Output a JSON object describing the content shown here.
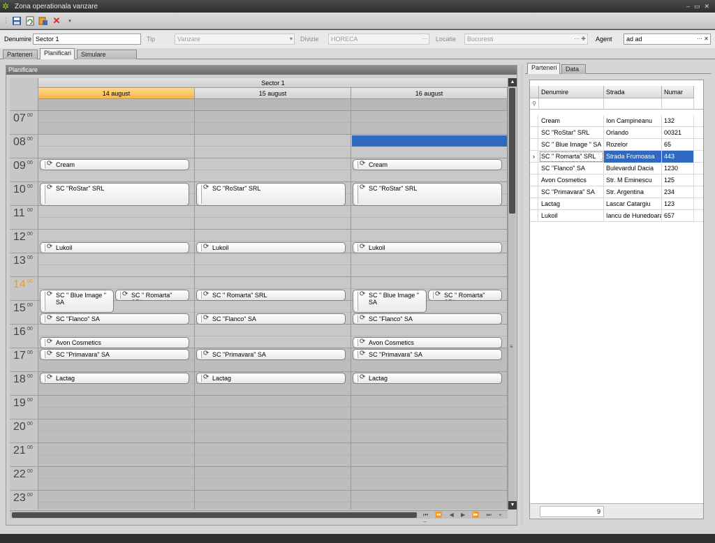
{
  "window": {
    "title": "Zona operationala vanzare",
    "controls": [
      "–",
      "▭",
      "✕"
    ]
  },
  "toolbar": {
    "buttons": [
      "save-icon",
      "refresh-icon",
      "add-icon",
      "delete-icon",
      "dropdown-icon"
    ]
  },
  "filters": {
    "denumire_label": "Denumire",
    "denumire_value": "Sector 1",
    "tip_label": "Tip",
    "tip_value": "Vanzare",
    "divizie_label": "Divizie",
    "divizie_value": "HORECA",
    "locatie_label": "Locatie",
    "locatie_value": "Bucuresti",
    "agent_label": "Agent",
    "agent_value": "ad ad"
  },
  "main_tabs": [
    "Parteneri",
    "Planificari",
    "Simulare planificari"
  ],
  "main_tab_active": 1,
  "planificare": {
    "panel_title": "Planificare",
    "group": "Sector 1",
    "days": [
      "14 august",
      "15 august",
      "16 august"
    ],
    "today_index": 0,
    "hours": [
      "07",
      "08",
      "09",
      "10",
      "11",
      "12",
      "13",
      "14",
      "15",
      "16",
      "17",
      "18",
      "19",
      "20",
      "21",
      "22",
      "23"
    ],
    "minutes_label": "00",
    "current_hour": "14",
    "selected_slot": {
      "day": 2,
      "time": "08:00"
    },
    "appointments": [
      {
        "day": 0,
        "start": "09:00",
        "end": "09:30",
        "col": 0,
        "cols": 1,
        "text": "Cream"
      },
      {
        "day": 2,
        "start": "09:00",
        "end": "09:30",
        "col": 0,
        "cols": 1,
        "text": "Cream"
      },
      {
        "day": 0,
        "start": "10:00",
        "end": "11:00",
        "col": 0,
        "cols": 1,
        "text": "SC \"RoStar\" SRL"
      },
      {
        "day": 1,
        "start": "10:00",
        "end": "11:00",
        "col": 0,
        "cols": 1,
        "text": "SC \"RoStar\" SRL"
      },
      {
        "day": 2,
        "start": "10:00",
        "end": "11:00",
        "col": 0,
        "cols": 1,
        "text": "SC \"RoStar\" SRL"
      },
      {
        "day": 0,
        "start": "12:30",
        "end": "13:00",
        "col": 0,
        "cols": 1,
        "text": "Lukoil"
      },
      {
        "day": 1,
        "start": "12:30",
        "end": "13:00",
        "col": 0,
        "cols": 1,
        "text": "Lukoil"
      },
      {
        "day": 2,
        "start": "12:30",
        "end": "13:00",
        "col": 0,
        "cols": 1,
        "text": "Lukoil"
      },
      {
        "day": 0,
        "start": "14:30",
        "end": "15:30",
        "col": 0,
        "cols": 2,
        "text": "SC \" Blue Image \" SA"
      },
      {
        "day": 0,
        "start": "14:30",
        "end": "15:00",
        "col": 1,
        "cols": 2,
        "text": "SC \" Romarta\" SRL"
      },
      {
        "day": 1,
        "start": "14:30",
        "end": "15:00",
        "col": 0,
        "cols": 1,
        "text": "SC \" Romarta\" SRL"
      },
      {
        "day": 2,
        "start": "14:30",
        "end": "15:30",
        "col": 0,
        "cols": 2,
        "text": "SC \" Blue Image \" SA"
      },
      {
        "day": 2,
        "start": "14:30",
        "end": "15:00",
        "col": 1,
        "cols": 2,
        "text": "SC \" Romarta\" SRL"
      },
      {
        "day": 0,
        "start": "15:30",
        "end": "16:00",
        "col": 0,
        "cols": 1,
        "text": "SC \"Flanco\" SA"
      },
      {
        "day": 1,
        "start": "15:30",
        "end": "16:00",
        "col": 0,
        "cols": 1,
        "text": "SC \"Flanco\" SA"
      },
      {
        "day": 2,
        "start": "15:30",
        "end": "16:00",
        "col": 0,
        "cols": 1,
        "text": "SC \"Flanco\" SA"
      },
      {
        "day": 0,
        "start": "16:30",
        "end": "17:00",
        "col": 0,
        "cols": 1,
        "text": "Avon Cosmetics"
      },
      {
        "day": 2,
        "start": "16:30",
        "end": "17:00",
        "col": 0,
        "cols": 1,
        "text": "Avon Cosmetics"
      },
      {
        "day": 0,
        "start": "17:00",
        "end": "17:30",
        "col": 0,
        "cols": 1,
        "text": "SC \"Primavara\" SA"
      },
      {
        "day": 1,
        "start": "17:00",
        "end": "17:30",
        "col": 0,
        "cols": 1,
        "text": "SC \"Primavara\" SA"
      },
      {
        "day": 2,
        "start": "17:00",
        "end": "17:30",
        "col": 0,
        "cols": 1,
        "text": "SC \"Primavara\" SA"
      },
      {
        "day": 0,
        "start": "18:00",
        "end": "18:30",
        "col": 0,
        "cols": 1,
        "text": "Lactag"
      },
      {
        "day": 1,
        "start": "18:00",
        "end": "18:30",
        "col": 0,
        "cols": 1,
        "text": "Lactag"
      },
      {
        "day": 2,
        "start": "18:00",
        "end": "18:30",
        "col": 0,
        "cols": 1,
        "text": "Lactag"
      }
    ],
    "nav_buttons": "⏮ ⏪ ◀ ▶ ⏩ ⏭ + −"
  },
  "side_tabs": [
    "Parteneri",
    "Data"
  ],
  "side_tab_active": 0,
  "partners_grid": {
    "columns": [
      "Denumire",
      "Strada",
      "Numar"
    ],
    "filter_icon": "filter-icon",
    "rows": [
      [
        "Cream",
        "Ion Campineanu",
        "132"
      ],
      [
        "SC \"RoStar\" SRL",
        "Orlando",
        "00321"
      ],
      [
        "SC \" Blue Image \" SA",
        "Rozelor",
        "65"
      ],
      [
        "SC \" Romarta\" SRL",
        "Strada Frumoasa",
        "443"
      ],
      [
        "SC \"Flanco\" SA",
        "Bulevardul Dacia",
        "1230"
      ],
      [
        "Avon Cosmetics",
        "Str. M Eminescu",
        "125"
      ],
      [
        "SC \"Primavara\" SA",
        "Str. Argentina",
        "234"
      ],
      [
        "Lactag",
        "Lascar Catargiu",
        "123"
      ],
      [
        "Lukoil",
        "Iancu de Hunedoara",
        "657"
      ]
    ],
    "selected_row": 3,
    "count": "9"
  },
  "colors": {
    "selection": "#2f69c2",
    "today": "#f7b64d",
    "current_hour": "#e8a020"
  }
}
